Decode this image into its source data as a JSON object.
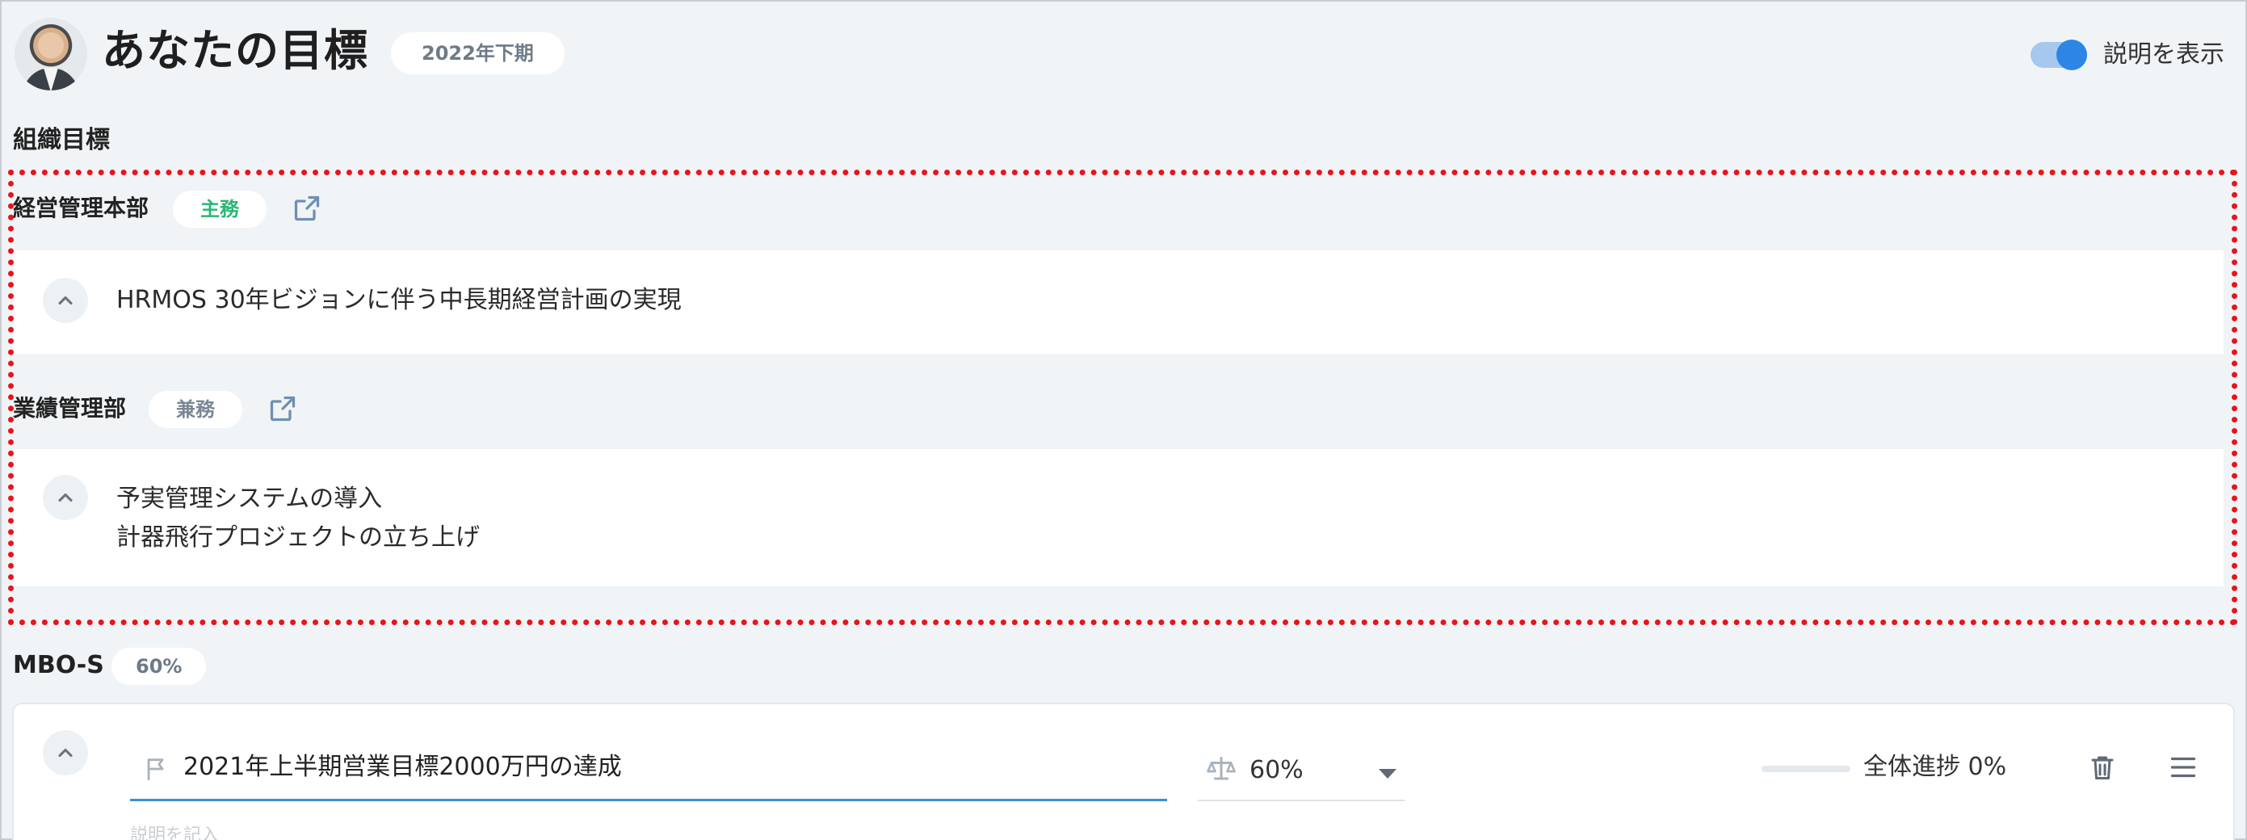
{
  "header": {
    "title": "あなたの目標",
    "period": "2022年下期",
    "toggle_label": "説明を表示",
    "toggle_on": true
  },
  "org_section": {
    "label": "組織目標",
    "departments": [
      {
        "name": "経営管理本部",
        "role": "主務",
        "role_color": "#2bb673",
        "goals": [
          "HRMOS 30年ビジョンに伴う中長期経営計画の実現"
        ]
      },
      {
        "name": "業績管理部",
        "role": "兼務",
        "role_color": "#7b8794",
        "goals": [
          "予実管理システムの導入",
          "計器飛行プロジェクトの立ち上げ"
        ]
      }
    ]
  },
  "mbo": {
    "label": "MBO-S",
    "percent": "60%",
    "goal_title": "2021年上半期営業目標2000万円の達成",
    "weight": "60%",
    "progress_label": "全体進捗 0%",
    "progress_fraction": 0,
    "description_placeholder": "説明を記入"
  },
  "colors": {
    "accent": "#2d86e6",
    "highlight_border": "#e8141c",
    "background": "#f1f4f6"
  },
  "icons": [
    "external-link-icon",
    "chevron-up-icon",
    "flag-icon",
    "scale-icon",
    "caret-down-icon",
    "trash-icon",
    "menu-icon"
  ]
}
